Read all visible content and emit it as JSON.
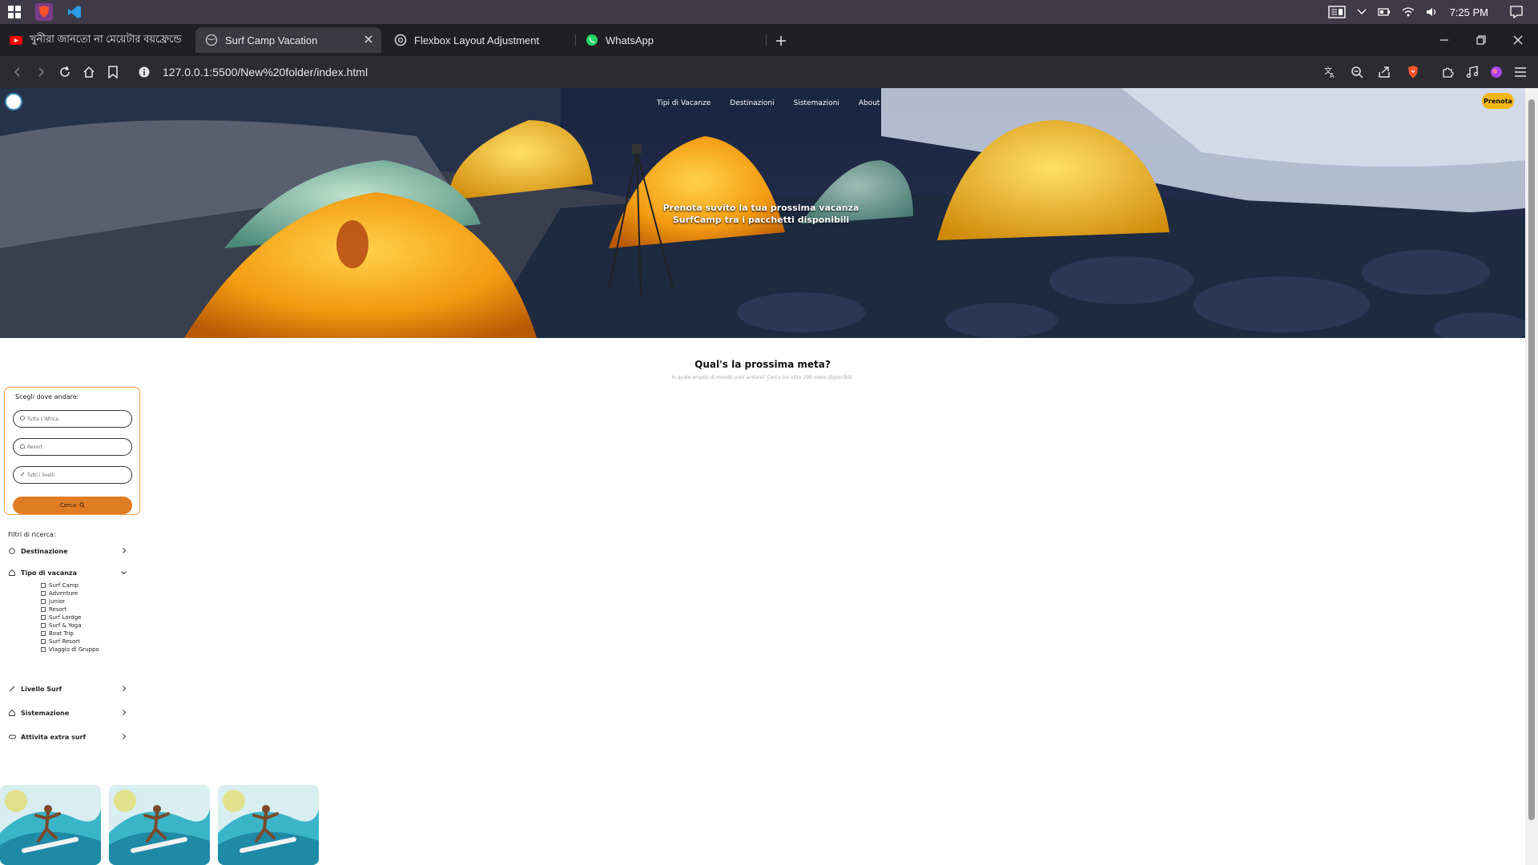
{
  "os": {
    "time": "7:25 PM"
  },
  "tabs": [
    {
      "label": "খুনীরা জানতো না মেয়েটার বয়ফ্রেন্ডে"
    },
    {
      "label": "Surf Camp Vacation"
    },
    {
      "label": "Flexbox Layout Adjustment"
    },
    {
      "label": "WhatsApp"
    }
  ],
  "address": {
    "url": "127.0.0.1:5500/New%20folder/index.html"
  },
  "hero": {
    "nav": [
      "Tipi di Vacanze",
      "Destinazioni",
      "Sistemazioni",
      "About"
    ],
    "cta": "Prenota",
    "headline_1": "Prenota suvito la tua prossima vacanza",
    "headline_2": "SurfCamp tra i pacchetti disponibili"
  },
  "section": {
    "title": "Qual's la prossima meta?",
    "subtitle": "In quale angolo di mondo vuoi andare? Cerca tra oltre 200 mete disponibili."
  },
  "search": {
    "label": "Scegli dove andare:",
    "destination_placeholder": "Tutta L'Africa",
    "stay_placeholder": "Resort",
    "level_placeholder": "Tutti i livelli",
    "button": "Cerca"
  },
  "filters": {
    "title": "Filtri di ricerca:",
    "groups": [
      {
        "label": "Destinazione"
      },
      {
        "label": "Tipo di vacanza"
      },
      {
        "label": "Livello Surf"
      },
      {
        "label": "Sistemazione"
      },
      {
        "label": "Attivita extra surf"
      }
    ],
    "vacation_types": [
      "Surf Camp",
      "Adventure",
      "Junior",
      "Resort",
      "Surf Lordge",
      "Surf & Yoga",
      "Boat Trip",
      "Surf Resort",
      "Viaggio di Gruppo"
    ]
  },
  "colors": {
    "accent": "#e07c24",
    "cta": "#f3b511",
    "border": "#f0a04b"
  }
}
